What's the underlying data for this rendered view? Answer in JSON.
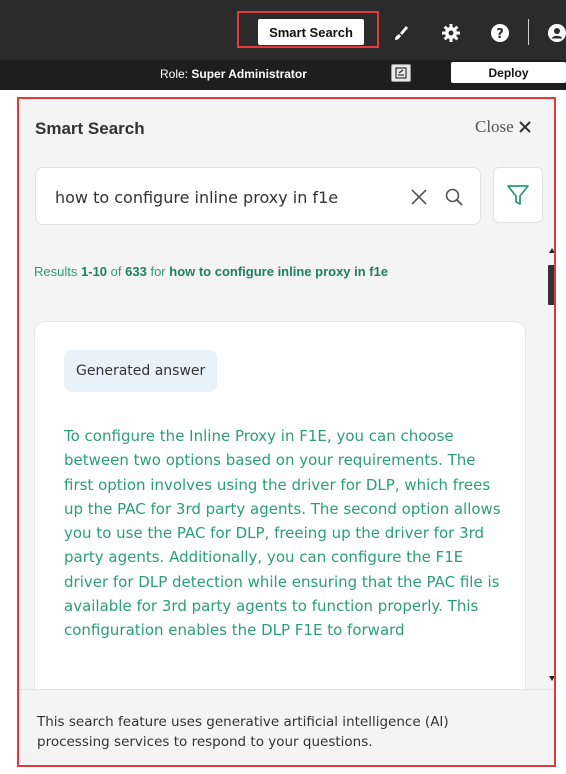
{
  "header": {
    "smart_search_label": "Smart Search",
    "role_label": "Role:",
    "role_value": "Super Administrator",
    "deploy_label": "Deploy"
  },
  "panel": {
    "title": "Smart Search",
    "close_label": "Close",
    "search": {
      "value": "how to configure inline proxy in f1e",
      "placeholder": ""
    },
    "results": {
      "prefix": "Results",
      "range_start": "1",
      "dash": "-",
      "range_end": "10",
      "of_word": "of",
      "total": "633",
      "for_word": "for",
      "query": "how to configure inline proxy in f1e"
    },
    "card": {
      "badge": "Generated answer",
      "answer": "To configure the Inline Proxy in F1E, you can choose between two options based on your requirements. The first option involves using the driver for DLP, which frees up the PAC for 3rd party agents. The second option allows you to use the PAC for DLP, freeing up the driver for 3rd party agents. Additionally, you can configure the F1E driver for DLP detection while ensuring that the PAC file is available for 3rd party agents to function properly. This configuration enables the DLP F1E to forward"
    },
    "footer": {
      "disclaimer": "This search feature uses generative artificial intelligence (AI) processing services to respond to your questions."
    }
  },
  "colors": {
    "highlight": "#e03a3a",
    "accent_teal": "#2a9d7a",
    "topbar": "#2b2b2b",
    "badge_bg": "#e9f1fb"
  },
  "icons": [
    "brush-icon",
    "gear-icon",
    "help-icon",
    "user-icon",
    "notes-icon",
    "close-x-icon",
    "clear-icon",
    "search-icon",
    "filter-icon"
  ]
}
